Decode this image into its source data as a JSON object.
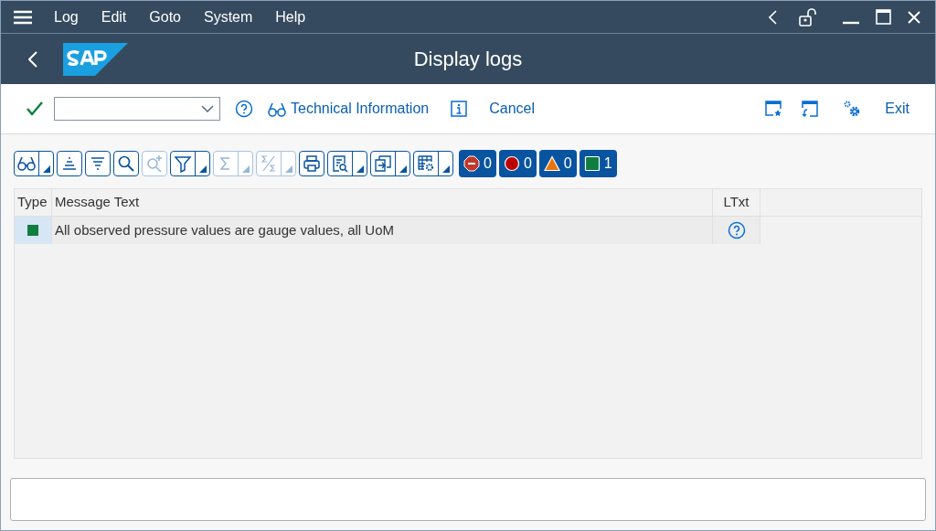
{
  "menu": [
    "Log",
    "Edit",
    "Goto",
    "System",
    "Help"
  ],
  "title": "Display logs",
  "app_toolbar": [
    {
      "kind": "check"
    },
    {
      "kind": "command_field"
    },
    {
      "kind": "help"
    },
    {
      "kind": "glasses_link",
      "label": "Technical Information"
    },
    {
      "kind": "info"
    },
    {
      "kind": "link",
      "label": "Cancel"
    }
  ],
  "app_toolbar_right": [
    {
      "kind": "star_window"
    },
    {
      "kind": "new_window"
    },
    {
      "kind": "settings"
    },
    {
      "kind": "link",
      "label": "Exit"
    }
  ],
  "alv_toolbar": [
    {
      "kind": "glasses",
      "dropdown": true,
      "disabled": false
    },
    {
      "kind": "sort_up",
      "dropdown": false,
      "disabled": false
    },
    {
      "kind": "sort_down",
      "dropdown": false,
      "disabled": false
    },
    {
      "kind": "search",
      "dropdown": false,
      "disabled": false
    },
    {
      "kind": "search_next",
      "dropdown": false,
      "disabled": true
    },
    {
      "kind": "filter",
      "dropdown": true,
      "disabled": false
    },
    {
      "kind": "sum",
      "dropdown": true,
      "disabled": true
    },
    {
      "kind": "subtotal",
      "dropdown": true,
      "disabled": true
    },
    {
      "kind": "print",
      "dropdown": false,
      "disabled": false
    },
    {
      "kind": "view",
      "dropdown": true,
      "disabled": false
    },
    {
      "kind": "export",
      "dropdown": true,
      "disabled": false
    },
    {
      "kind": "layout",
      "dropdown": true,
      "disabled": false
    }
  ],
  "counters": [
    {
      "kind": "stop",
      "count": "0"
    },
    {
      "kind": "error",
      "count": "0"
    },
    {
      "kind": "warning",
      "count": "0"
    },
    {
      "kind": "success",
      "count": "1"
    }
  ],
  "table": {
    "columns": [
      "Type",
      "Message Text",
      "LTxt"
    ],
    "rows": [
      {
        "kind": "success",
        "message": "All observed pressure values are gauge values, all UoM"
      }
    ]
  }
}
